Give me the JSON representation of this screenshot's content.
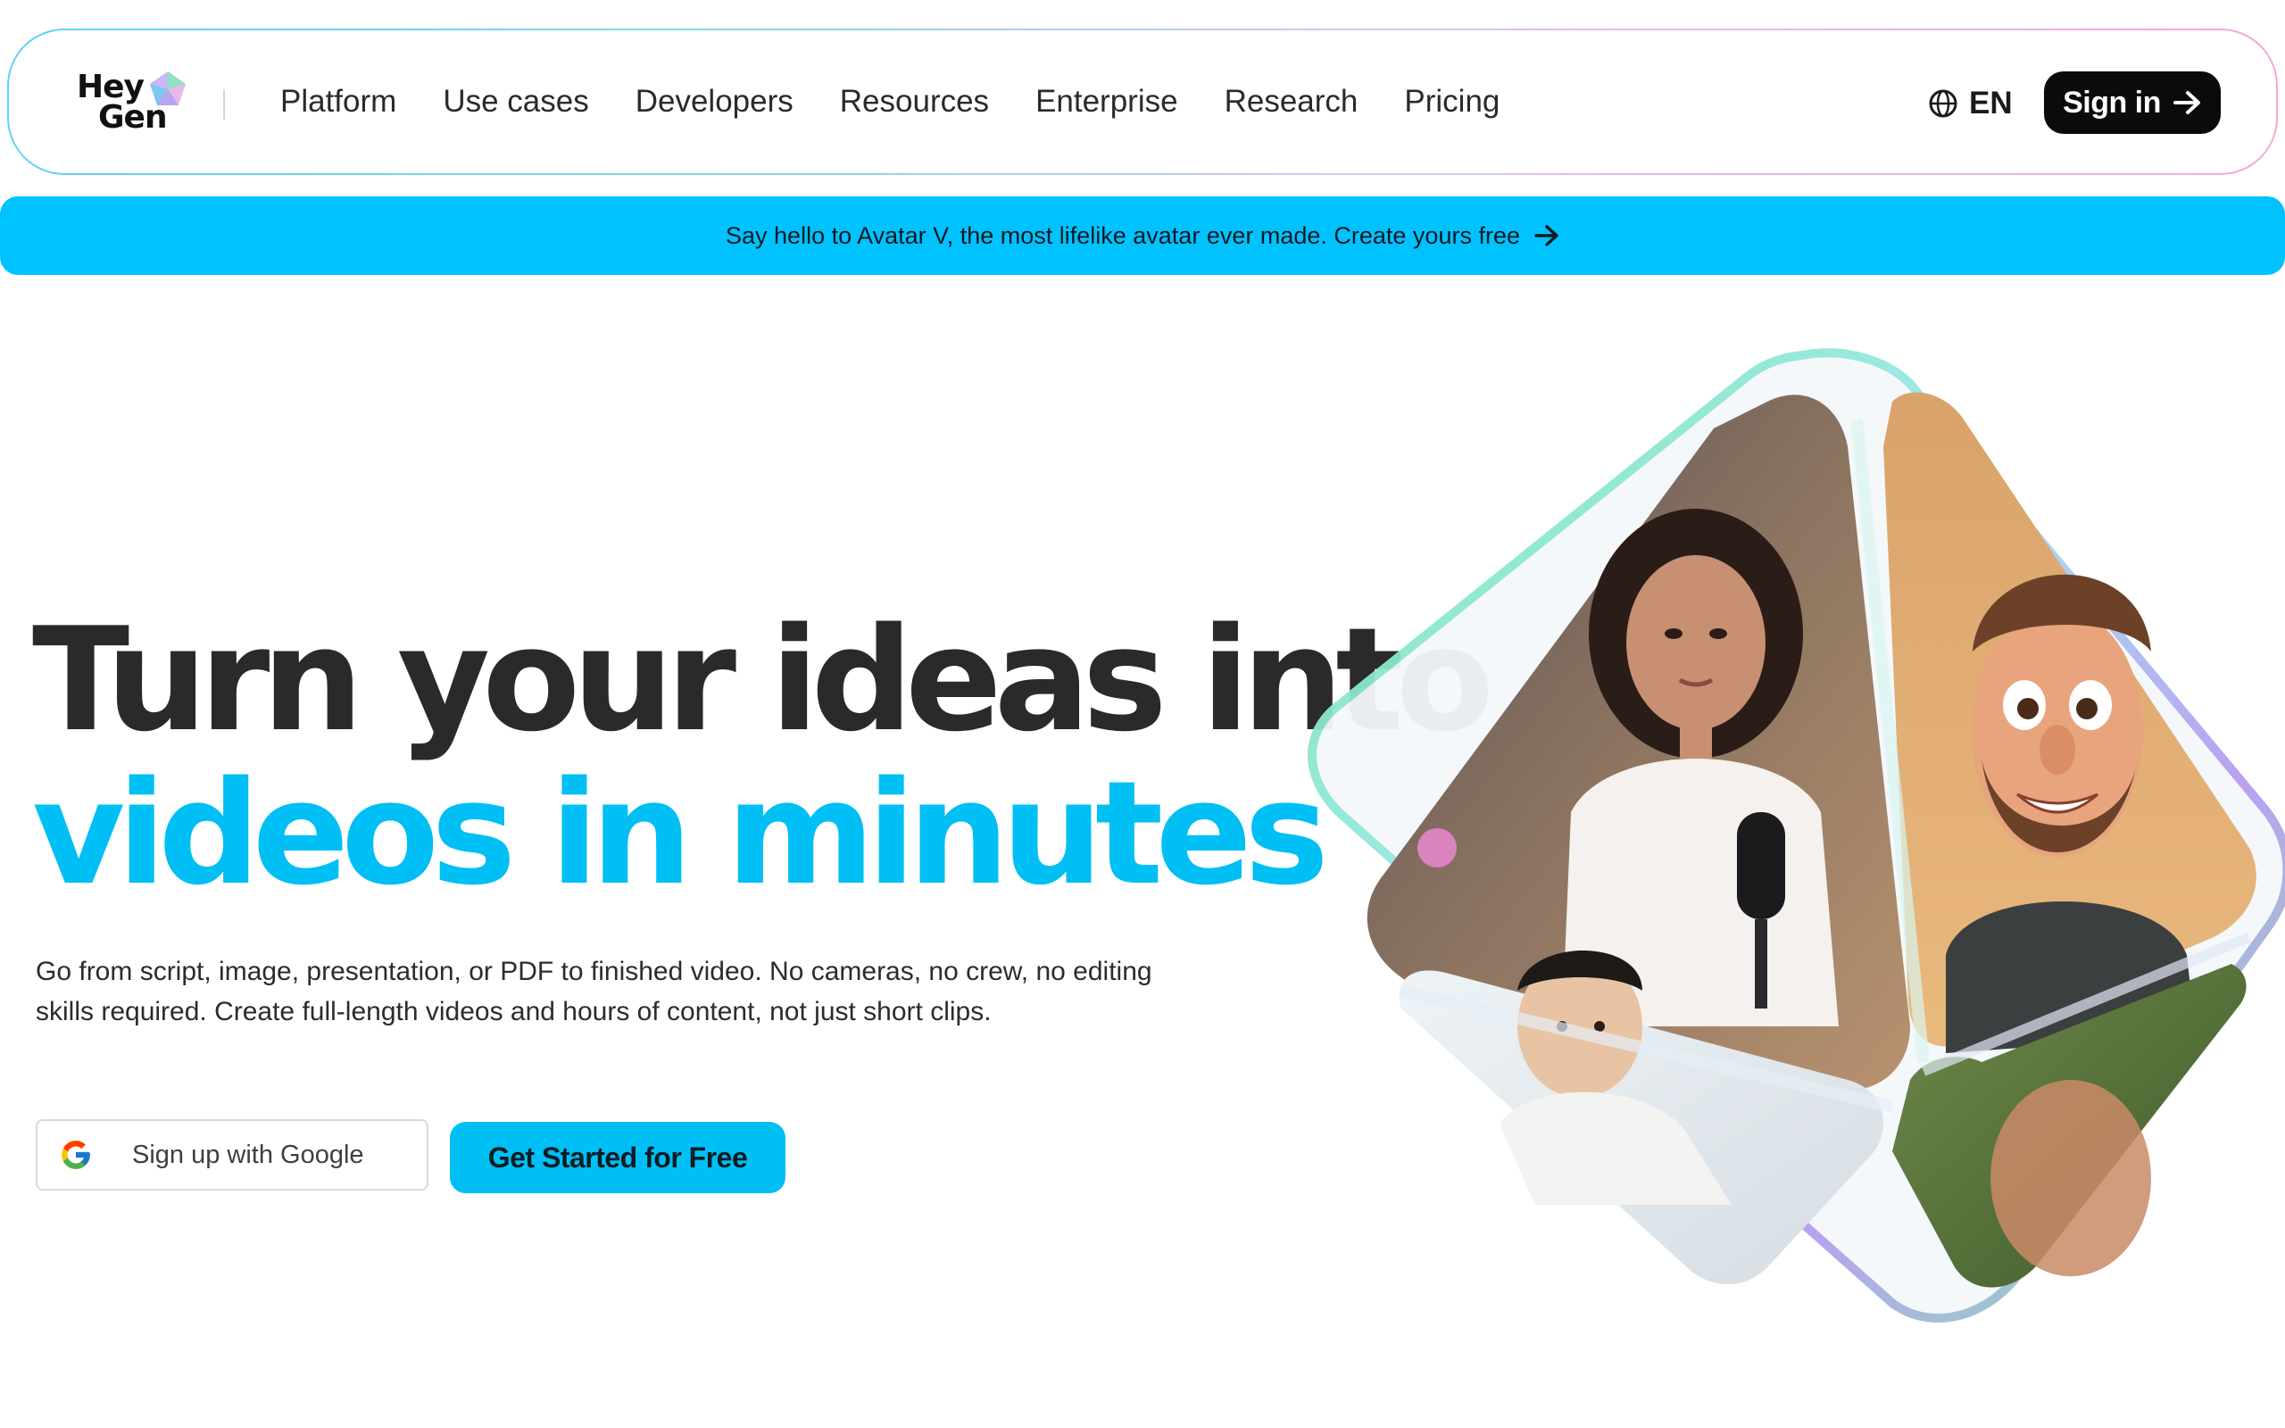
{
  "brand": {
    "logo_line1": "Hey",
    "logo_line2": "Gen"
  },
  "nav": {
    "links": [
      "Platform",
      "Use cases",
      "Developers",
      "Resources",
      "Enterprise",
      "Research",
      "Pricing"
    ],
    "language": "EN",
    "signin_label": "Sign in"
  },
  "banner": {
    "text": "Say hello to Avatar V, the most lifelike avatar ever made. Create yours free"
  },
  "hero": {
    "headline_line1": "Turn your ideas into",
    "headline_line2": "videos in minutes",
    "subtext": "Go from script, image, presentation, or PDF to finished video. No cameras, no crew, no editing skills required. Create full-length videos and hours of content, not just short clips.",
    "google_button": "Sign up with Google",
    "cta_button": "Get Started for Free"
  },
  "colors": {
    "accent": "#00bff5",
    "banner": "#00c2ff",
    "dark_button": "#0b0b0b",
    "headline": "#2a2a2a"
  },
  "icons": {
    "language": "globe-icon",
    "signin": "arrow-right-icon",
    "banner": "arrow-right-icon",
    "google": "google-g-icon",
    "logo_mark": "heygen-gem-icon"
  }
}
